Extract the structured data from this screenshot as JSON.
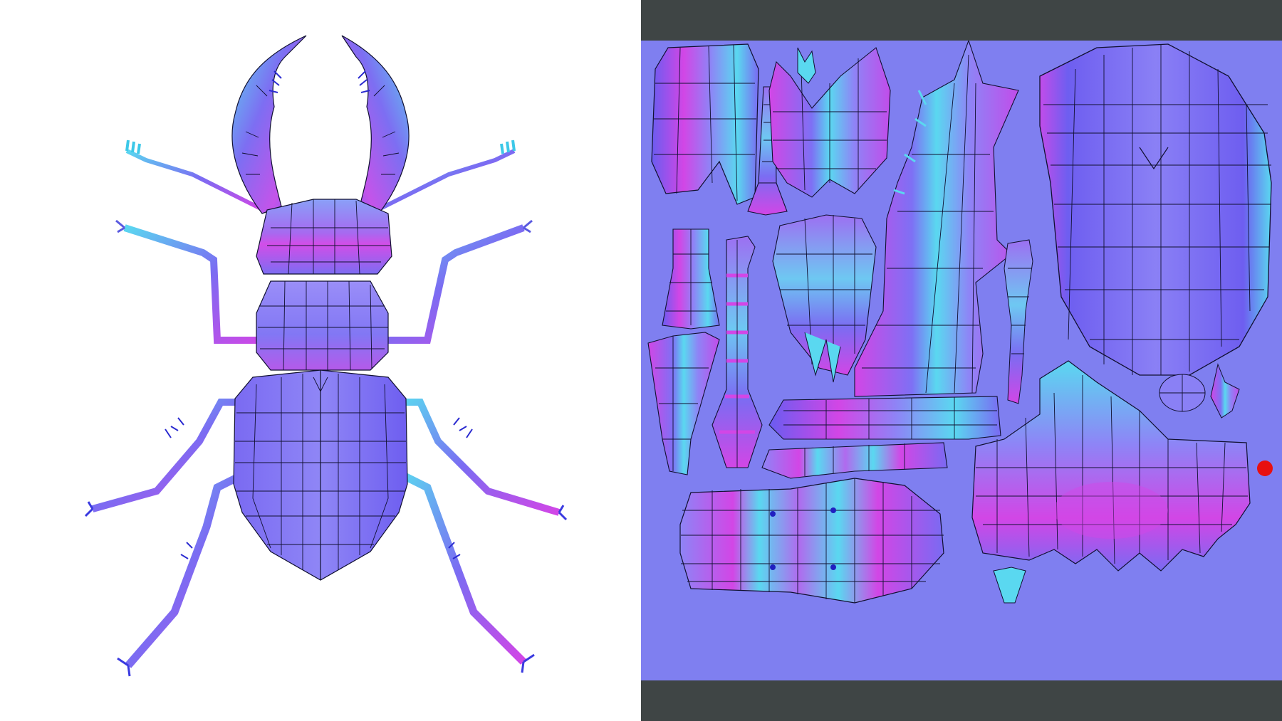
{
  "colors": {
    "background_left": "#ffffff",
    "frame_dark": "#3f4545",
    "uv_background": "#7f7ff0",
    "normal_blue": "#8a7cf5",
    "normal_magenta": "#d246e6",
    "normal_cyan": "#5ad8f0",
    "normal_violet": "#6e5df0",
    "marker_red": "#e81010"
  },
  "views": {
    "left": "beetle-3d-normal-map-view",
    "right": "uv-layout-normal-texture"
  },
  "icons": {
    "marker": "red-dot-marker"
  }
}
